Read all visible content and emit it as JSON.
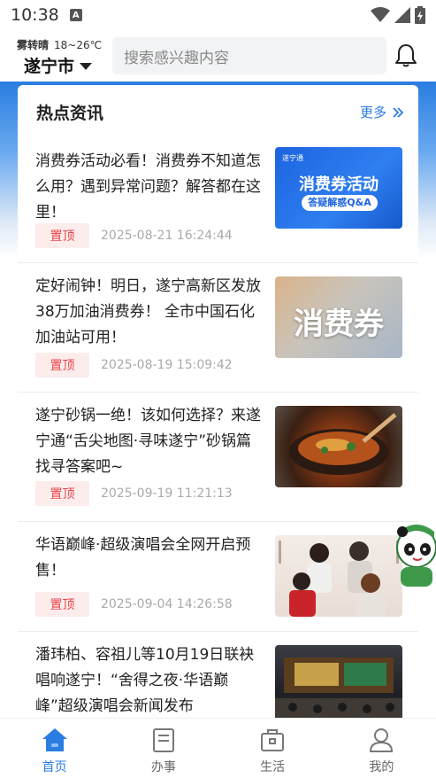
{
  "status_bar": {
    "time": "10:38",
    "notification_icon": "A"
  },
  "header": {
    "weather_text": "雾转晴",
    "temperature": "18~26℃",
    "city": "遂宁市",
    "search_placeholder": "搜索感兴趣内容"
  },
  "section": {
    "title": "热点资讯",
    "more_label": "更多"
  },
  "news": [
    {
      "title": "消费券活动必看！消费券不知道怎么用？遇到异常问题？解答都在这里！",
      "pin_label": "置顶",
      "time": "2025-08-21 16:24:44",
      "thumb_text": "消费券活动",
      "thumb_pill": "答疑解惑Q&A",
      "thumb_logo": "遂宁通"
    },
    {
      "title": "定好闹钟！明日，遂宁高新区发放38万加油消费券！ 全市中国石化加油站可用！",
      "pin_label": "置顶",
      "time": "2025-08-19 15:09:42",
      "thumb_text": "消费券"
    },
    {
      "title": "遂宁砂锅一绝！该如何选择？来遂宁通“舌尖地图·寻味遂宁”砂锅篇找寻答案吧~",
      "pin_label": "置顶",
      "time": "2025-09-19 11:21:13"
    },
    {
      "title": "华语巅峰·超级演唱会全网开启预售！",
      "pin_label": "置顶",
      "time": "2025-09-04 14:26:58"
    },
    {
      "title": "潘玮柏、容祖儿等10月19日联袂唱响遂宁！“舍得之夜·华语巅峰”超级演唱会新闻发布"
    }
  ],
  "bottom_nav": [
    {
      "label": "首页",
      "icon": "home-icon",
      "active": true
    },
    {
      "label": "办事",
      "icon": "book-icon",
      "active": false
    },
    {
      "label": "生活",
      "icon": "briefcase-icon",
      "active": false
    },
    {
      "label": "我的",
      "icon": "user-icon",
      "active": false
    }
  ],
  "colors": {
    "accent": "#2a7de1",
    "pin_text": "#e6454a",
    "pin_bg": "#fdecec"
  }
}
